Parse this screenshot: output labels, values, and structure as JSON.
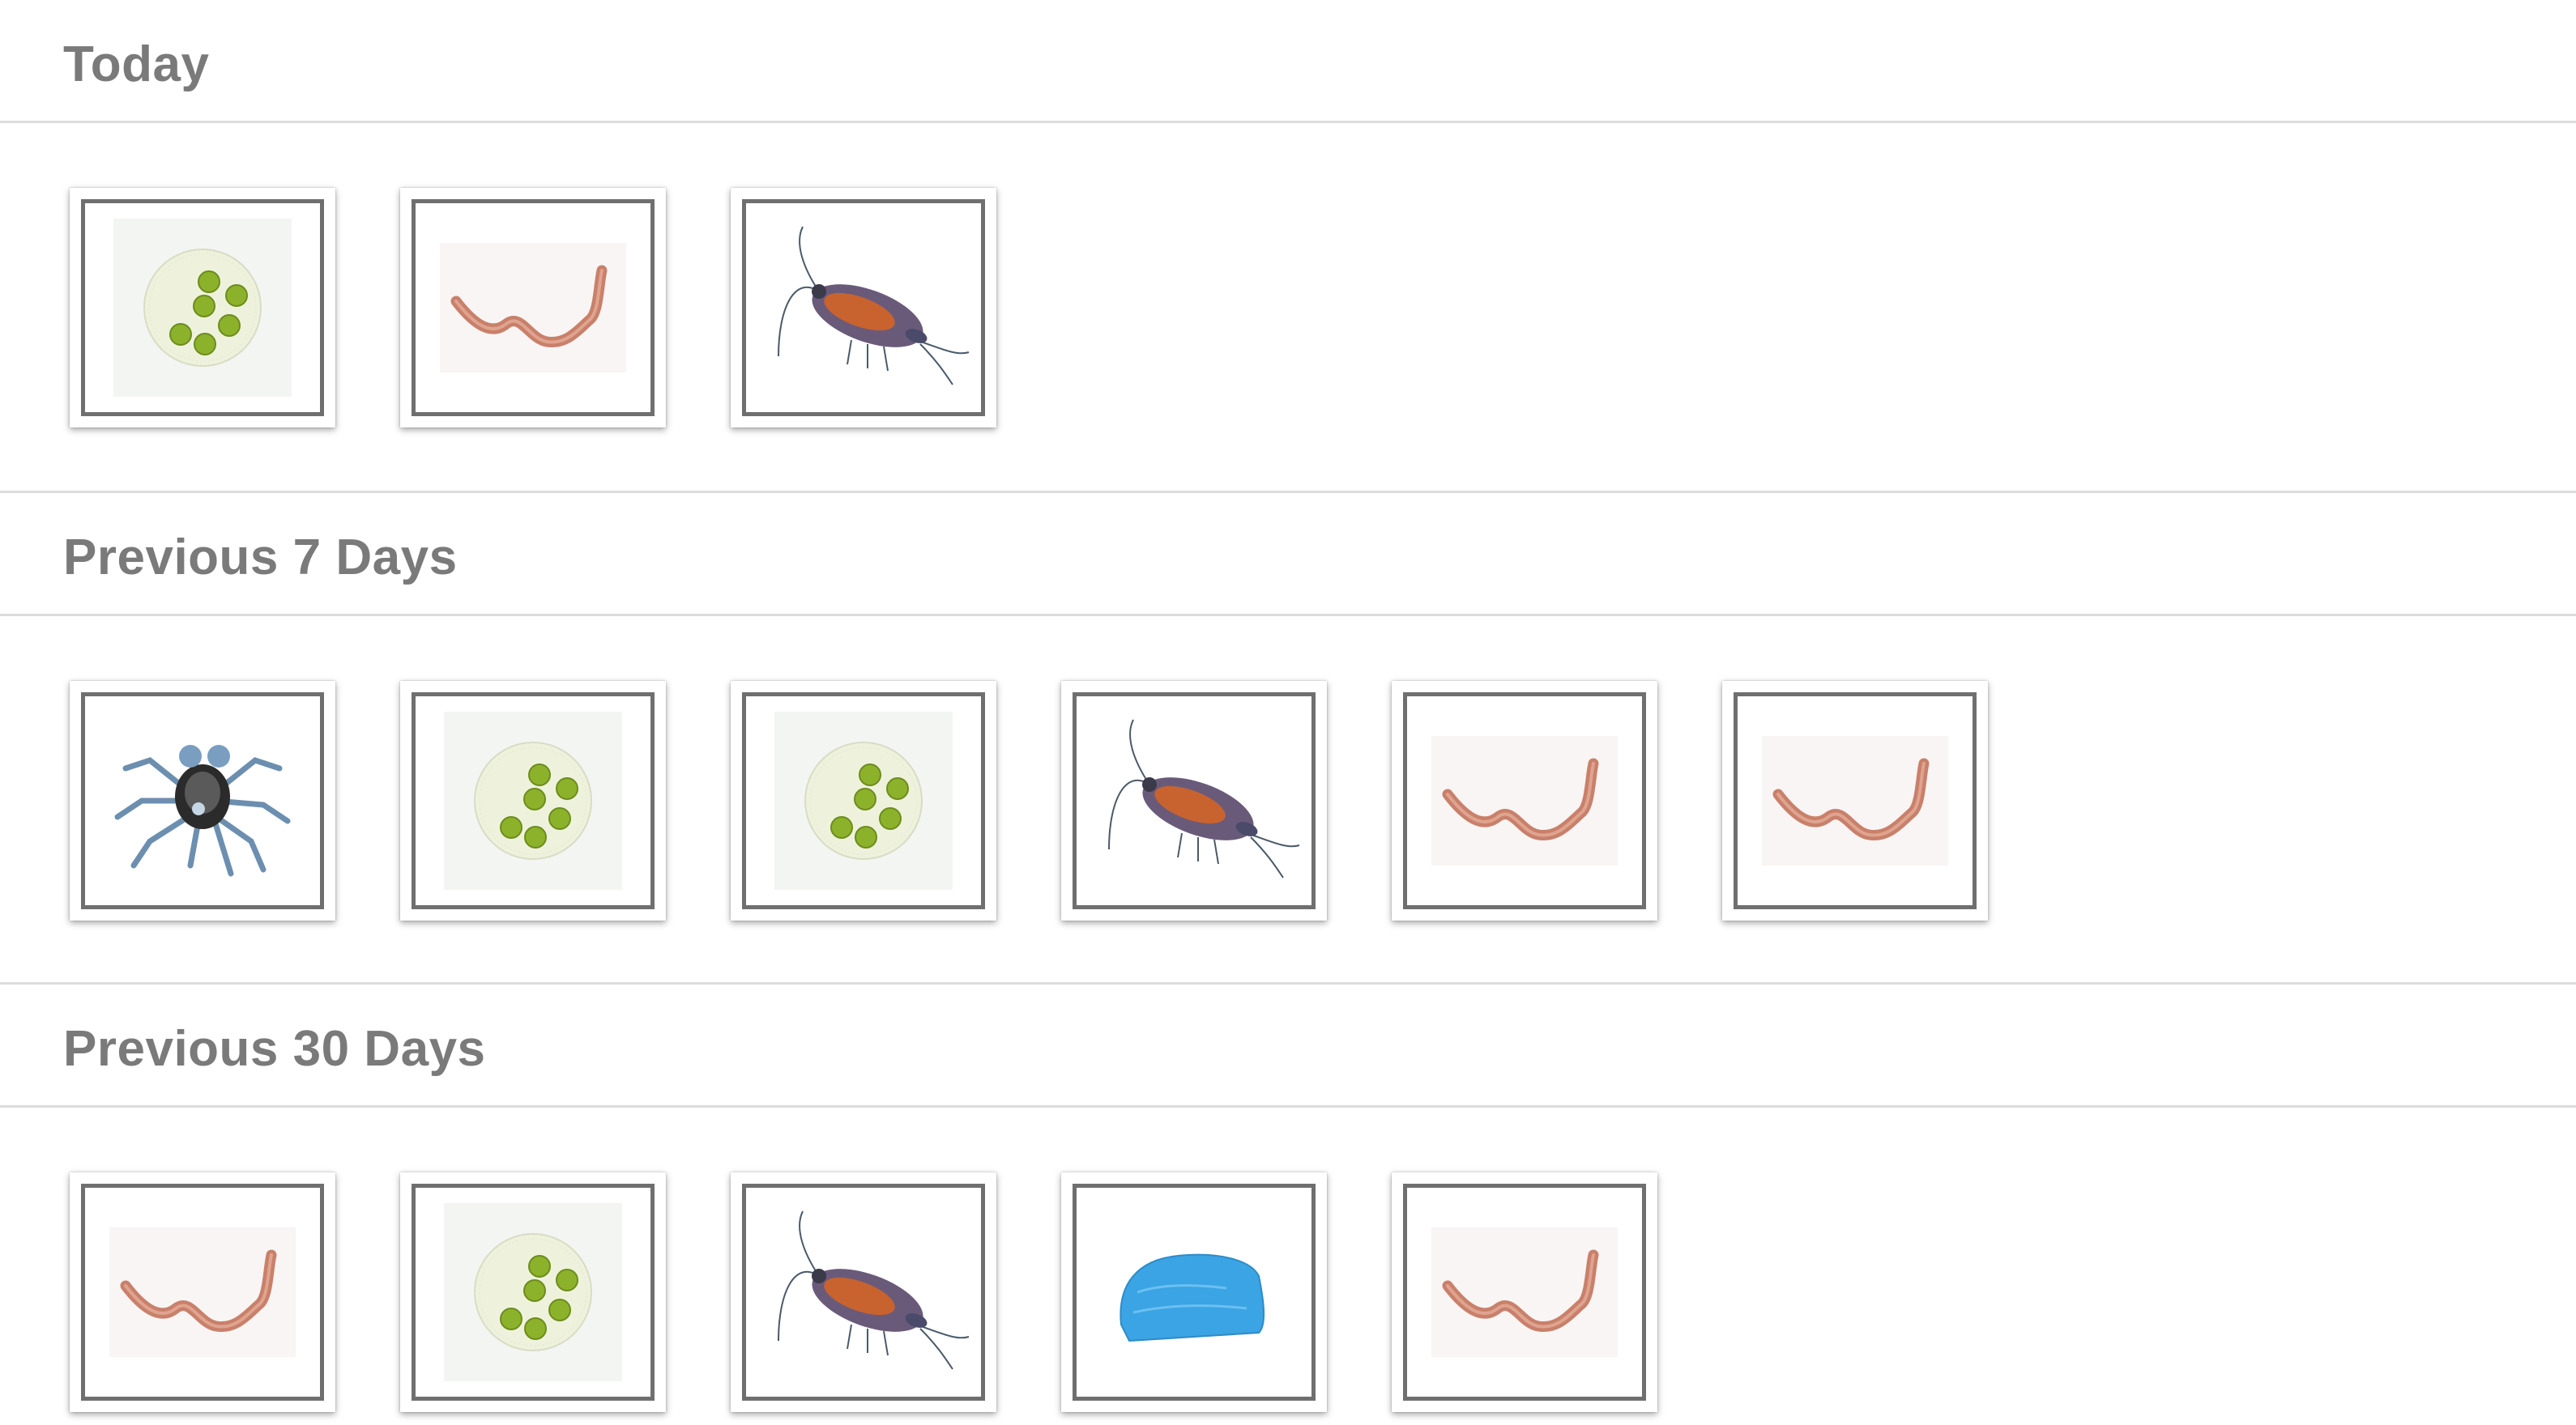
{
  "sections": [
    {
      "title": "Today",
      "items": [
        {
          "icon": "green-algae-icon"
        },
        {
          "icon": "worm-icon"
        },
        {
          "icon": "copepod-icon"
        }
      ]
    },
    {
      "title": "Previous 7 Days",
      "items": [
        {
          "icon": "spider-crab-icon"
        },
        {
          "icon": "green-algae-icon"
        },
        {
          "icon": "green-algae-icon"
        },
        {
          "icon": "copepod-icon"
        },
        {
          "icon": "worm-icon"
        },
        {
          "icon": "worm-icon"
        }
      ]
    },
    {
      "title": "Previous 30 Days",
      "items": [
        {
          "icon": "worm-icon"
        },
        {
          "icon": "green-algae-icon"
        },
        {
          "icon": "copepod-icon"
        },
        {
          "icon": "blue-sponge-icon"
        },
        {
          "icon": "worm-icon"
        }
      ]
    }
  ],
  "colors": {
    "title_text": "#7a7a7a",
    "divider": "#dcdcdc",
    "frame": "#6f6f6f",
    "algae_green": "#8cb22b",
    "worm_pink": "#c9806a",
    "copepod_orange": "#c8632f",
    "sponge_blue": "#3aa4e4"
  }
}
